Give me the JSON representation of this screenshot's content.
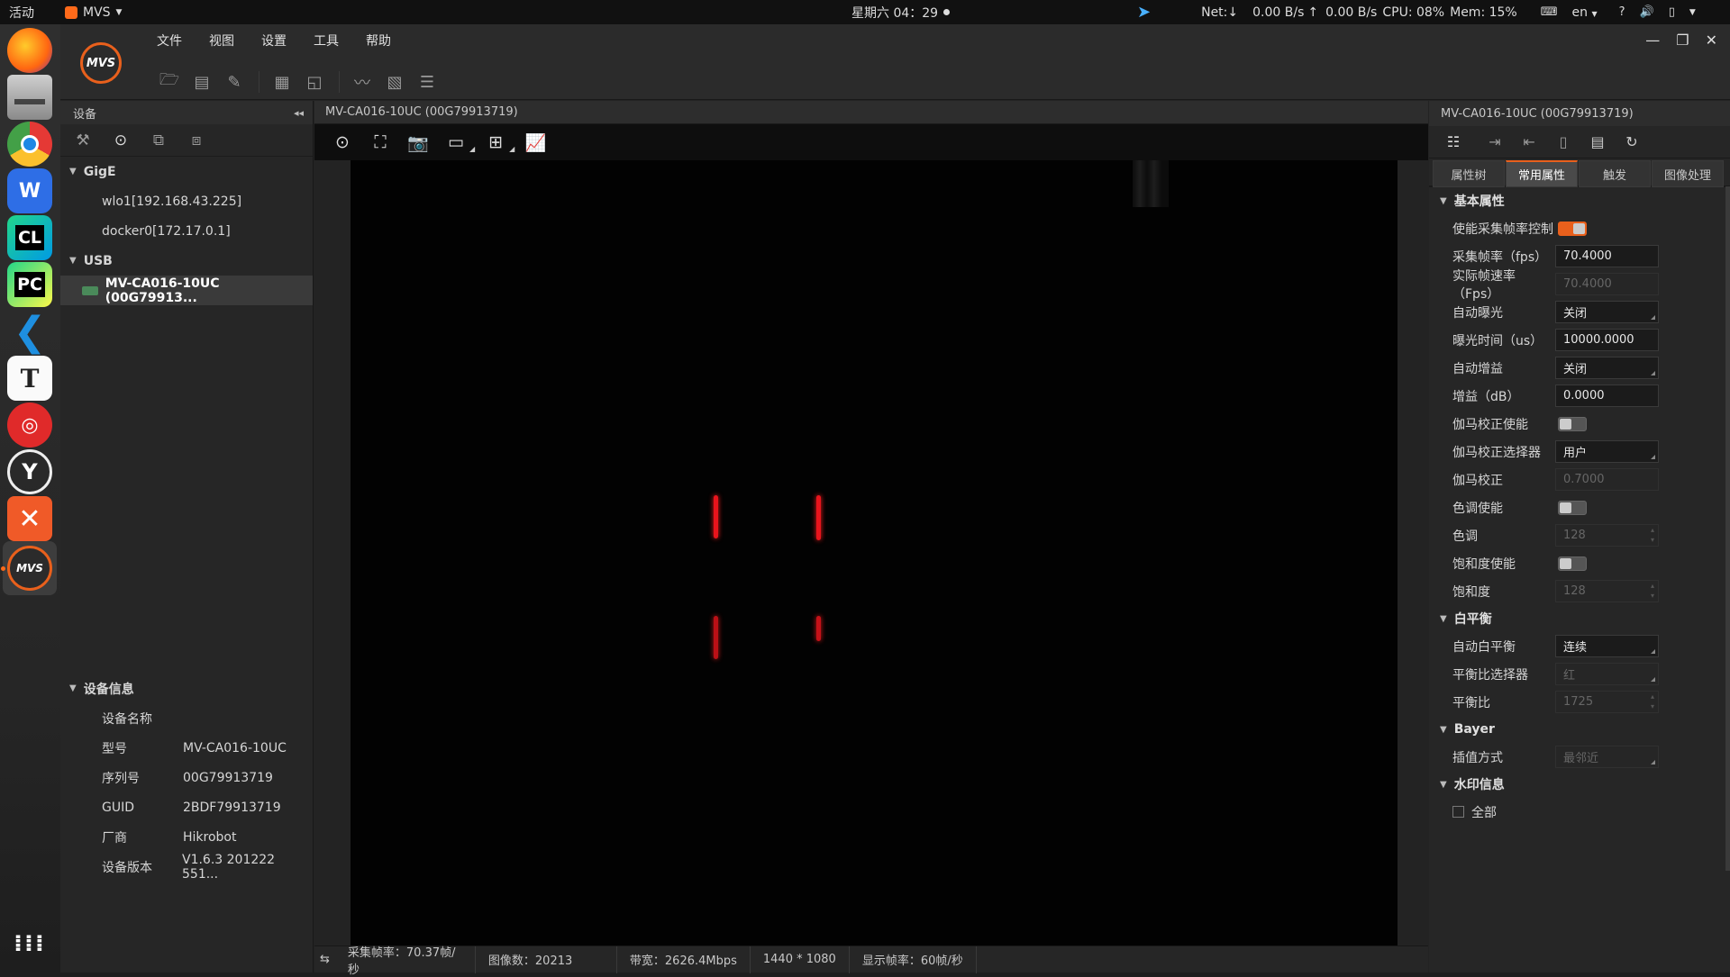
{
  "system": {
    "activities": "活动",
    "app_name": "MVS",
    "clock": "星期六 04：29",
    "net": "Net:↓",
    "down": "0.00 B/s",
    "up_label": "↑",
    "up": "0.00 B/s",
    "cpu": "CPU: 08%",
    "mem": "Mem: 15%",
    "lang": "en"
  },
  "dock": [
    "firefox-icon",
    "files-icon",
    "chrome-icon",
    "wps-icon",
    "clion-icon",
    "pycharm-icon",
    "vscode-icon",
    "typora-icon",
    "netease-music-icon",
    "ubuntu-software-icon",
    "xmind-icon",
    "mvs-icon",
    "app-grid-icon"
  ],
  "menu": {
    "items": [
      "文件",
      "视图",
      "设置",
      "工具",
      "帮助"
    ]
  },
  "left": {
    "title": "设备",
    "groups": [
      {
        "name": "GigE",
        "items": [
          "wlo1[192.168.43.225]",
          "docker0[172.17.0.1]"
        ]
      },
      {
        "name": "USB",
        "items": [
          "MV-CA016-10UC (00G79913..."
        ]
      }
    ],
    "info_title": "设备信息",
    "info": [
      {
        "k": "设备名称",
        "v": ""
      },
      {
        "k": "型号",
        "v": "MV-CA016-10UC"
      },
      {
        "k": "序列号",
        "v": "00G79913719"
      },
      {
        "k": "GUID",
        "v": "2BDF79913719"
      },
      {
        "k": "厂商",
        "v": "Hikrobot"
      },
      {
        "k": "设备版本",
        "v": "V1.6.3 201222 551..."
      }
    ]
  },
  "center": {
    "title": "MV-CA016-10UC (00G79913719)",
    "status": [
      "采集帧率：70.37帧/秒",
      "图像数：20213",
      "带宽：2626.4Mbps",
      "1440 * 1080",
      "显示帧率：60帧/秒"
    ]
  },
  "right": {
    "title": "MV-CA016-10UC (00G79913719)",
    "tabs": [
      "属性树",
      "常用属性",
      "触发",
      "图像处理"
    ],
    "sections": {
      "basic": "基本属性",
      "wb": "白平衡",
      "bayer": "Bayer",
      "watermark": "水印信息"
    },
    "props": {
      "p1": {
        "label": "使能采集帧率控制",
        "toggle": "on"
      },
      "p2": {
        "label": "采集帧率（fps）",
        "value": "70.4000"
      },
      "p3": {
        "label": "实际帧速率（Fps）",
        "value": "70.4000"
      },
      "p4": {
        "label": "自动曝光",
        "value": "关闭"
      },
      "p5": {
        "label": "曝光时间（us）",
        "value": "10000.0000"
      },
      "p6": {
        "label": "自动增益",
        "value": "关闭"
      },
      "p7": {
        "label": "增益（dB）",
        "value": "0.0000"
      },
      "p8": {
        "label": "伽马校正使能",
        "toggle": "off"
      },
      "p9": {
        "label": "伽马校正选择器",
        "value": "用户"
      },
      "p10": {
        "label": "伽马校正",
        "value": "0.7000"
      },
      "p11": {
        "label": "色调使能",
        "toggle": "off"
      },
      "p12": {
        "label": "色调",
        "value": "128"
      },
      "p13": {
        "label": "饱和度使能",
        "toggle": "off"
      },
      "p14": {
        "label": "饱和度",
        "value": "128"
      },
      "p15": {
        "label": "自动白平衡",
        "value": "连续"
      },
      "p16": {
        "label": "平衡比选择器",
        "value": "红"
      },
      "p17": {
        "label": "平衡比",
        "value": "1725"
      },
      "p18": {
        "label": "插值方式",
        "value": "最邻近"
      },
      "p19": {
        "label": "全部"
      }
    }
  },
  "colors": {
    "accent": "#e9601c",
    "laser": "#e8141c"
  }
}
